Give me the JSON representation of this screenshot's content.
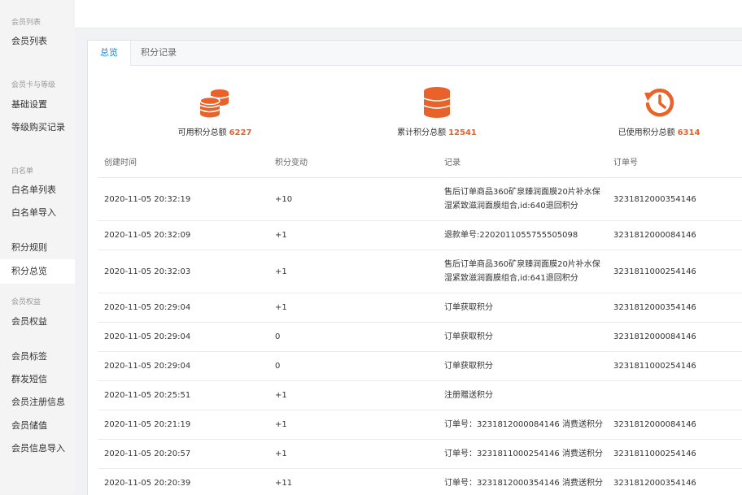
{
  "sidebar": {
    "groups": [
      {
        "title": "会员列表",
        "items": [
          {
            "label": "会员列表"
          }
        ]
      },
      {
        "title": "会员卡与等级",
        "items": [
          {
            "label": "基础设置"
          },
          {
            "label": "等级购买记录"
          }
        ]
      },
      {
        "title": "白名单",
        "items": [
          {
            "label": "白名单列表"
          },
          {
            "label": "白名单导入"
          },
          {
            "label": "积分规则"
          },
          {
            "label": "积分总览"
          }
        ]
      },
      {
        "title": "会员权益",
        "items": [
          {
            "label": "会员权益"
          },
          {
            "label": "会员标签"
          },
          {
            "label": "群发短信"
          },
          {
            "label": "会员注册信息"
          },
          {
            "label": "会员储值"
          },
          {
            "label": "会员信息导入"
          }
        ]
      }
    ],
    "active": "积分总览"
  },
  "tabs": [
    {
      "label": "总览",
      "active": true
    },
    {
      "label": "积分记录",
      "active": false
    }
  ],
  "stats": [
    {
      "label": "可用积分总额",
      "value": "6227",
      "icon": "coins-icon"
    },
    {
      "label": "累计积分总额",
      "value": "12541",
      "icon": "database-icon"
    },
    {
      "label": "已使用积分总额",
      "value": "6314",
      "icon": "history-icon"
    }
  ],
  "colors": {
    "accent": "#e8622a",
    "tab_active": "#1e88e5"
  },
  "table": {
    "headers": [
      "创建时间",
      "积分变动",
      "记录",
      "订单号"
    ],
    "rows": [
      {
        "time": "2020-11-05 20:32:19",
        "change": "+10",
        "record": "售后订单商品360矿泉臻润面膜20片补水保湿紧致滋润面膜组合,id:640退回积分",
        "order": "3231812000354146"
      },
      {
        "time": "2020-11-05 20:32:09",
        "change": "+1",
        "record": "退款单号:2202011055755505098",
        "order": "3231812000084146"
      },
      {
        "time": "2020-11-05 20:32:03",
        "change": "+1",
        "record": "售后订单商品360矿泉臻润面膜20片补水保湿紧致滋润面膜组合,id:641退回积分",
        "order": "3231811000254146"
      },
      {
        "time": "2020-11-05 20:29:04",
        "change": "+1",
        "record": "订单获取积分",
        "order": "3231812000354146"
      },
      {
        "time": "2020-11-05 20:29:04",
        "change": "0",
        "record": "订单获取积分",
        "order": "3231812000084146"
      },
      {
        "time": "2020-11-05 20:29:04",
        "change": "0",
        "record": "订单获取积分",
        "order": "3231811000254146"
      },
      {
        "time": "2020-11-05 20:25:51",
        "change": "+1",
        "record": "注册赠送积分",
        "order": ""
      },
      {
        "time": "2020-11-05 20:21:19",
        "change": "+1",
        "record": "订单号：3231812000084146 消费送积分",
        "order": "3231812000084146"
      },
      {
        "time": "2020-11-05 20:20:57",
        "change": "+1",
        "record": "订单号：3231811000254146 消费送积分",
        "order": "3231811000254146"
      },
      {
        "time": "2020-11-05 20:20:39",
        "change": "+11",
        "record": "订单号：3231812000354146 消费送积分",
        "order": "3231812000354146"
      }
    ]
  }
}
